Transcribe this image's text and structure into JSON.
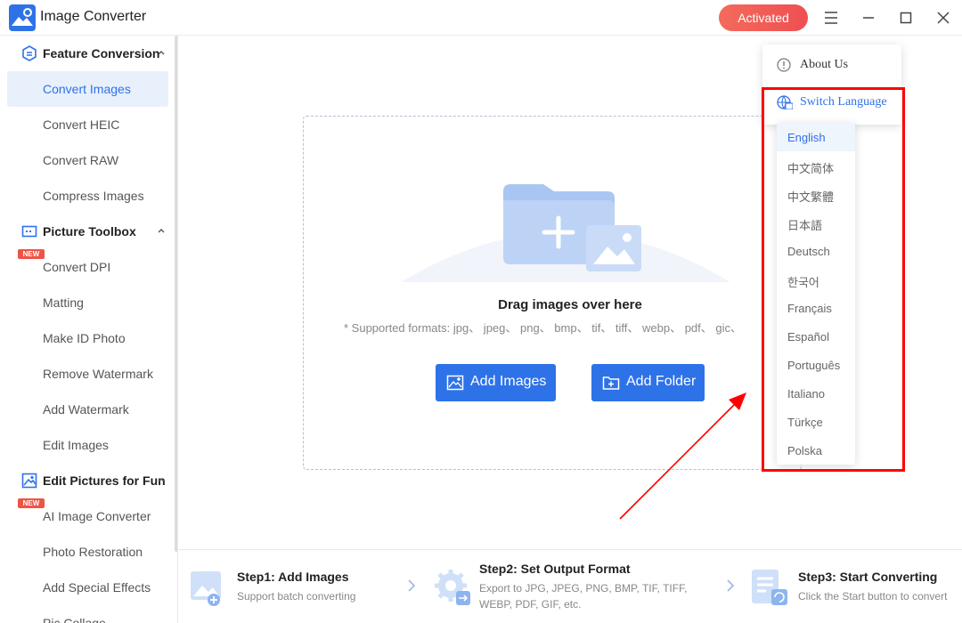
{
  "titlebar": {
    "app_title": "Image Converter",
    "activated_label": "Activated"
  },
  "sidebar": {
    "sections": [
      {
        "label": "Feature Conversion",
        "items": [
          "Convert Images",
          "Convert HEIC",
          "Convert RAW",
          "Compress Images"
        ]
      },
      {
        "label": "Picture Toolbox",
        "items": [
          "Convert DPI",
          "Matting",
          "Make ID Photo",
          "Remove Watermark",
          "Add Watermark",
          "Edit Images"
        ]
      },
      {
        "label": "Edit Pictures for Fun",
        "items": [
          "AI Image Converter",
          "Photo Restoration",
          "Add Special Effects",
          "Pic Collage"
        ]
      }
    ],
    "new_badge": "NEW"
  },
  "main": {
    "drag_text": "Drag images over here",
    "formats_text": "* Supported formats: jpg、 jpeg、 png、 bmp、 tif、 tiff、 webp、 pdf、 gic、",
    "add_images_label": "Add Images",
    "add_folder_label": "Add Folder"
  },
  "steps": [
    {
      "title": "Step1:  Add Images",
      "desc": "Support batch converting"
    },
    {
      "title": "Step2:  Set Output Format",
      "desc": "Export to JPG, JPEG, PNG, BMP, TIF, TIFF, WEBP, PDF, GIF, etc."
    },
    {
      "title": "Step3:  Start Converting",
      "desc": "Click the Start button to convert"
    }
  ],
  "menu": {
    "about_us": "About Us",
    "switch_language": "Switch Language",
    "languages": [
      "English",
      "中文简体",
      "中文繁體",
      "日本語",
      "Deutsch",
      "한국어",
      "Français",
      "Español",
      "Português",
      "Italiano",
      "Türkçe",
      "Polska"
    ],
    "selected_language": "English"
  },
  "colors": {
    "accent": "#2e72e8",
    "activated": "#ef5a55",
    "highlight": "#ff0000",
    "new_badge": "#ee5446"
  }
}
